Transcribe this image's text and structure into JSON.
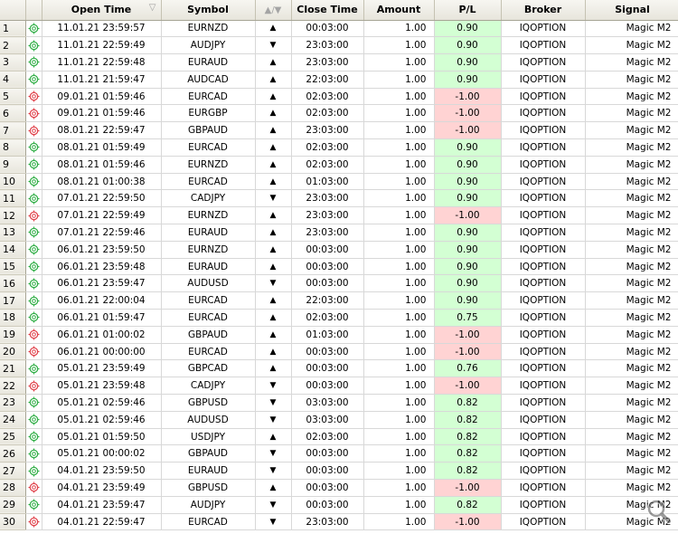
{
  "columns": {
    "open_time": "Open Time",
    "symbol": "Symbol",
    "direction": "▲/▼",
    "close_time": "Close Time",
    "amount": "Amount",
    "pl": "P/L",
    "broker": "Broker",
    "signal": "Signal"
  },
  "sort_indicator": "▽",
  "colors": {
    "profit_bg": "#d3ffd3",
    "loss_bg": "#ffd3d3",
    "profit_icon": "#2fae45",
    "loss_icon": "#e0414a"
  },
  "rows": [
    {
      "n": "1",
      "open": "11.01.21 23:59:57",
      "sym": "EURNZD",
      "dir": "▲",
      "close": "00:03:00",
      "amt": "1.00",
      "pl": "0.90",
      "broker": "IQOPTION",
      "signal": "Magic M2",
      "win": true
    },
    {
      "n": "2",
      "open": "11.01.21 22:59:49",
      "sym": "AUDJPY",
      "dir": "▼",
      "close": "23:03:00",
      "amt": "1.00",
      "pl": "0.90",
      "broker": "IQOPTION",
      "signal": "Magic M2",
      "win": true
    },
    {
      "n": "3",
      "open": "11.01.21 22:59:48",
      "sym": "EURAUD",
      "dir": "▲",
      "close": "23:03:00",
      "amt": "1.00",
      "pl": "0.90",
      "broker": "IQOPTION",
      "signal": "Magic M2",
      "win": true
    },
    {
      "n": "4",
      "open": "11.01.21 21:59:47",
      "sym": "AUDCAD",
      "dir": "▲",
      "close": "22:03:00",
      "amt": "1.00",
      "pl": "0.90",
      "broker": "IQOPTION",
      "signal": "Magic M2",
      "win": true
    },
    {
      "n": "5",
      "open": "09.01.21 01:59:46",
      "sym": "EURCAD",
      "dir": "▲",
      "close": "02:03:00",
      "amt": "1.00",
      "pl": "-1.00",
      "broker": "IQOPTION",
      "signal": "Magic M2",
      "win": false
    },
    {
      "n": "6",
      "open": "09.01.21 01:59:46",
      "sym": "EURGBP",
      "dir": "▲",
      "close": "02:03:00",
      "amt": "1.00",
      "pl": "-1.00",
      "broker": "IQOPTION",
      "signal": "Magic M2",
      "win": false
    },
    {
      "n": "7",
      "open": "08.01.21 22:59:47",
      "sym": "GBPAUD",
      "dir": "▲",
      "close": "23:03:00",
      "amt": "1.00",
      "pl": "-1.00",
      "broker": "IQOPTION",
      "signal": "Magic M2",
      "win": false
    },
    {
      "n": "8",
      "open": "08.01.21 01:59:49",
      "sym": "EURCAD",
      "dir": "▲",
      "close": "02:03:00",
      "amt": "1.00",
      "pl": "0.90",
      "broker": "IQOPTION",
      "signal": "Magic M2",
      "win": true
    },
    {
      "n": "9",
      "open": "08.01.21 01:59:46",
      "sym": "EURNZD",
      "dir": "▲",
      "close": "02:03:00",
      "amt": "1.00",
      "pl": "0.90",
      "broker": "IQOPTION",
      "signal": "Magic M2",
      "win": true
    },
    {
      "n": "10",
      "open": "08.01.21 01:00:38",
      "sym": "EURCAD",
      "dir": "▲",
      "close": "01:03:00",
      "amt": "1.00",
      "pl": "0.90",
      "broker": "IQOPTION",
      "signal": "Magic M2",
      "win": true
    },
    {
      "n": "11",
      "open": "07.01.21 22:59:50",
      "sym": "CADJPY",
      "dir": "▼",
      "close": "23:03:00",
      "amt": "1.00",
      "pl": "0.90",
      "broker": "IQOPTION",
      "signal": "Magic M2",
      "win": true
    },
    {
      "n": "12",
      "open": "07.01.21 22:59:49",
      "sym": "EURNZD",
      "dir": "▲",
      "close": "23:03:00",
      "amt": "1.00",
      "pl": "-1.00",
      "broker": "IQOPTION",
      "signal": "Magic M2",
      "win": false
    },
    {
      "n": "13",
      "open": "07.01.21 22:59:46",
      "sym": "EURAUD",
      "dir": "▲",
      "close": "23:03:00",
      "amt": "1.00",
      "pl": "0.90",
      "broker": "IQOPTION",
      "signal": "Magic M2",
      "win": true
    },
    {
      "n": "14",
      "open": "06.01.21 23:59:50",
      "sym": "EURNZD",
      "dir": "▲",
      "close": "00:03:00",
      "amt": "1.00",
      "pl": "0.90",
      "broker": "IQOPTION",
      "signal": "Magic M2",
      "win": true
    },
    {
      "n": "15",
      "open": "06.01.21 23:59:48",
      "sym": "EURAUD",
      "dir": "▲",
      "close": "00:03:00",
      "amt": "1.00",
      "pl": "0.90",
      "broker": "IQOPTION",
      "signal": "Magic M2",
      "win": true
    },
    {
      "n": "16",
      "open": "06.01.21 23:59:47",
      "sym": "AUDUSD",
      "dir": "▼",
      "close": "00:03:00",
      "amt": "1.00",
      "pl": "0.90",
      "broker": "IQOPTION",
      "signal": "Magic M2",
      "win": true
    },
    {
      "n": "17",
      "open": "06.01.21 22:00:04",
      "sym": "EURCAD",
      "dir": "▲",
      "close": "22:03:00",
      "amt": "1.00",
      "pl": "0.90",
      "broker": "IQOPTION",
      "signal": "Magic M2",
      "win": true
    },
    {
      "n": "18",
      "open": "06.01.21 01:59:47",
      "sym": "EURCAD",
      "dir": "▲",
      "close": "02:03:00",
      "amt": "1.00",
      "pl": "0.75",
      "broker": "IQOPTION",
      "signal": "Magic M2",
      "win": true
    },
    {
      "n": "19",
      "open": "06.01.21 01:00:02",
      "sym": "GBPAUD",
      "dir": "▲",
      "close": "01:03:00",
      "amt": "1.00",
      "pl": "-1.00",
      "broker": "IQOPTION",
      "signal": "Magic M2",
      "win": false
    },
    {
      "n": "20",
      "open": "06.01.21 00:00:00",
      "sym": "EURCAD",
      "dir": "▲",
      "close": "00:03:00",
      "amt": "1.00",
      "pl": "-1.00",
      "broker": "IQOPTION",
      "signal": "Magic M2",
      "win": false
    },
    {
      "n": "21",
      "open": "05.01.21 23:59:49",
      "sym": "GBPCAD",
      "dir": "▲",
      "close": "00:03:00",
      "amt": "1.00",
      "pl": "0.76",
      "broker": "IQOPTION",
      "signal": "Magic M2",
      "win": true
    },
    {
      "n": "22",
      "open": "05.01.21 23:59:48",
      "sym": "CADJPY",
      "dir": "▼",
      "close": "00:03:00",
      "amt": "1.00",
      "pl": "-1.00",
      "broker": "IQOPTION",
      "signal": "Magic M2",
      "win": false
    },
    {
      "n": "23",
      "open": "05.01.21 02:59:46",
      "sym": "GBPUSD",
      "dir": "▼",
      "close": "03:03:00",
      "amt": "1.00",
      "pl": "0.82",
      "broker": "IQOPTION",
      "signal": "Magic M2",
      "win": true
    },
    {
      "n": "24",
      "open": "05.01.21 02:59:46",
      "sym": "AUDUSD",
      "dir": "▼",
      "close": "03:03:00",
      "amt": "1.00",
      "pl": "0.82",
      "broker": "IQOPTION",
      "signal": "Magic M2",
      "win": true
    },
    {
      "n": "25",
      "open": "05.01.21 01:59:50",
      "sym": "USDJPY",
      "dir": "▲",
      "close": "02:03:00",
      "amt": "1.00",
      "pl": "0.82",
      "broker": "IQOPTION",
      "signal": "Magic M2",
      "win": true
    },
    {
      "n": "26",
      "open": "05.01.21 00:00:02",
      "sym": "GBPAUD",
      "dir": "▼",
      "close": "00:03:00",
      "amt": "1.00",
      "pl": "0.82",
      "broker": "IQOPTION",
      "signal": "Magic M2",
      "win": true
    },
    {
      "n": "27",
      "open": "04.01.21 23:59:50",
      "sym": "EURAUD",
      "dir": "▼",
      "close": "00:03:00",
      "amt": "1.00",
      "pl": "0.82",
      "broker": "IQOPTION",
      "signal": "Magic M2",
      "win": true
    },
    {
      "n": "28",
      "open": "04.01.21 23:59:49",
      "sym": "GBPUSD",
      "dir": "▲",
      "close": "00:03:00",
      "amt": "1.00",
      "pl": "-1.00",
      "broker": "IQOPTION",
      "signal": "Magic M2",
      "win": false
    },
    {
      "n": "29",
      "open": "04.01.21 23:59:47",
      "sym": "AUDJPY",
      "dir": "▼",
      "close": "00:03:00",
      "amt": "1.00",
      "pl": "0.82",
      "broker": "IQOPTION",
      "signal": "Magic M2",
      "win": true
    },
    {
      "n": "30",
      "open": "04.01.21 22:59:47",
      "sym": "EURCAD",
      "dir": "▼",
      "close": "23:03:00",
      "amt": "1.00",
      "pl": "-1.00",
      "broker": "IQOPTION",
      "signal": "Magic M2",
      "win": false
    }
  ]
}
